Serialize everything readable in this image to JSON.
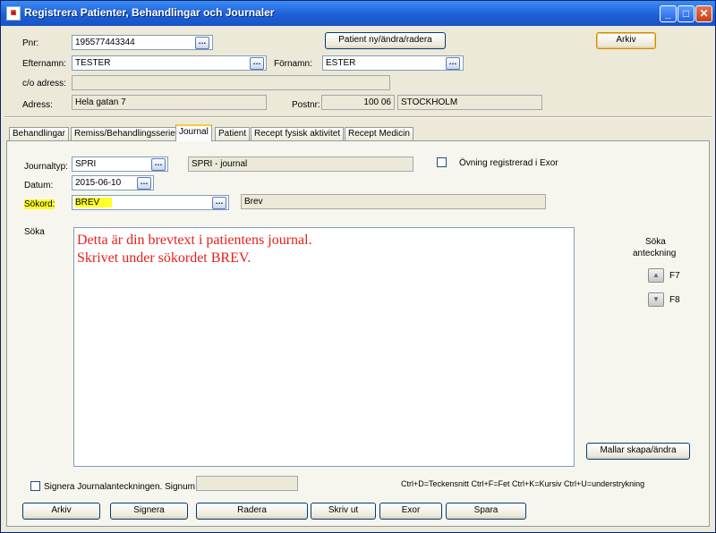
{
  "window": {
    "title": "Registrera Patienter, Behandlingar och Journaler",
    "icon": "app-icon",
    "min_icon": "minimize-icon",
    "max_icon": "maximize-icon",
    "close_icon": "close-icon"
  },
  "patient": {
    "pnr_label": "Pnr:",
    "pnr_value": "195577443344",
    "patient_button": "Patient ny/ändra/radera",
    "arkiv_button": "Arkiv",
    "efternamn_label": "Efternamn:",
    "efternamn_value": "TESTER",
    "fornamn_label": "Förnamn:",
    "fornamn_value": "ESTER",
    "co_label": "c/o adress:",
    "co_value": "",
    "adress_label": "Adress:",
    "adress_value": "Hela gatan 7",
    "postnr_label": "Postnr:",
    "postnr_value": "100 06",
    "ort_value": "STOCKHOLM"
  },
  "tabs": [
    {
      "label": "Behandlingar"
    },
    {
      "label": "Remiss/Behandlingsserie"
    },
    {
      "label": "Journal",
      "active": true
    },
    {
      "label": "Patient"
    },
    {
      "label": "Recept fysisk aktivitet"
    },
    {
      "label": "Recept Medicin"
    }
  ],
  "journal": {
    "typ_label": "Journaltyp:",
    "typ_value": "SPRI",
    "typ_desc": "SPRI - journal",
    "ovning_label": "Övning registrerad i Exor",
    "datum_label": "Datum:",
    "datum_value": "2015-06-10",
    "sokord_label": "Sökord:",
    "sokord_value": "BREV",
    "sokord_desc": "Brev",
    "soka_label": "Söka",
    "text_line1": "Detta är din brevtext i patientens journal.",
    "text_line2": "Skrivet under sökordet BREV.",
    "soka_anteckning_line1": "Söka",
    "soka_anteckning_line2": "anteckning",
    "f7": "F7",
    "f8": "F8",
    "mallar_button": "Mallar skapa/ändra",
    "signera_label": "Signera Journalanteckningen. Signum:",
    "signum_value": "",
    "shortcuts": "Ctrl+D=Teckensnitt Ctrl+F=Fet Ctrl+K=Kursiv Ctrl+U=understrykning",
    "highlight_color": "#ffff2a",
    "text_color": "#e8201a"
  },
  "bottom_buttons": {
    "arkiv": "Arkiv",
    "signera": "Signera",
    "radera": "Radera",
    "skrivut": "Skriv ut",
    "exor": "Exor",
    "spara": "Spara"
  }
}
